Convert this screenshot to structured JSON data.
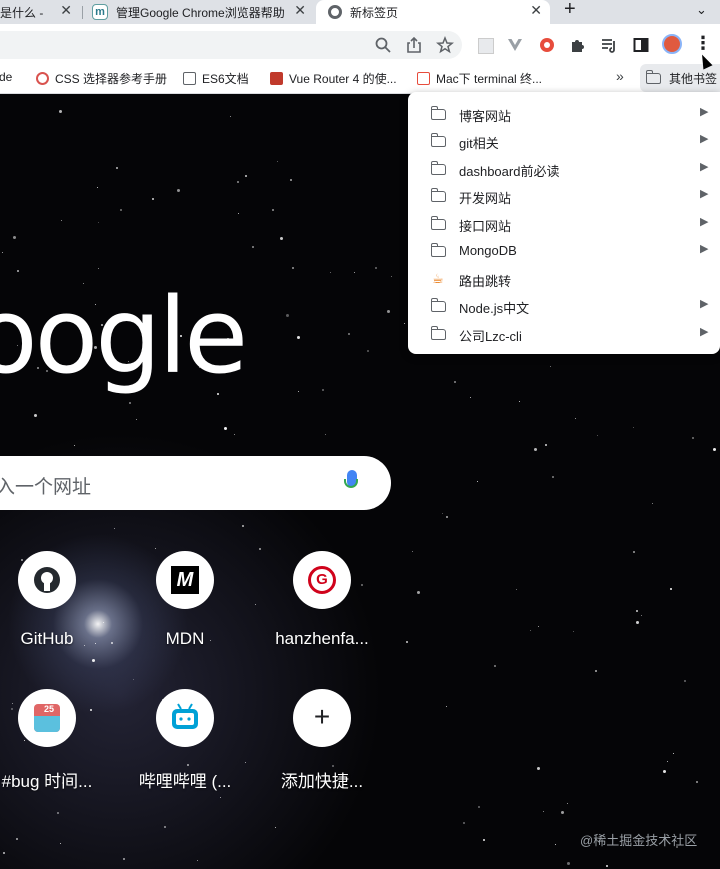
{
  "tabs": [
    {
      "title": "是什么 - ",
      "close": "✕"
    },
    {
      "title": "管理Google Chrome浏览器帮助",
      "close": "✕"
    },
    {
      "title": "新标签页",
      "close": "✕"
    }
  ],
  "toolbar": {
    "new_tab": "+",
    "tab_search": "⌄",
    "zoom_icon": "🔍",
    "share_icon": "⇪",
    "star_icon": "☆",
    "menu_icon": "⋮"
  },
  "bookmarks_bar": {
    "items": [
      {
        "label": "de",
        "icon": "none"
      },
      {
        "label": "CSS 选择器参考手册",
        "icon": "css-icon"
      },
      {
        "label": "ES6文档",
        "icon": "book-icon"
      },
      {
        "label": "Vue Router 4 的使...",
        "icon": "vue-icon"
      },
      {
        "label": "Mac下 terminal 终...",
        "icon": "code-icon"
      }
    ],
    "more": "»",
    "other": "其他书签"
  },
  "dropdown": {
    "items": [
      {
        "label": "博客网站",
        "type": "folder"
      },
      {
        "label": "git相关",
        "type": "folder"
      },
      {
        "label": "dashboard前必读",
        "type": "folder"
      },
      {
        "label": "开发网站",
        "type": "folder"
      },
      {
        "label": "接口网站",
        "type": "folder"
      },
      {
        "label": "MongoDB",
        "type": "folder"
      },
      {
        "label": "路由跳转",
        "type": "link"
      },
      {
        "label": "Node.js中文",
        "type": "folder"
      },
      {
        "label": "公司Lzc-cli",
        "type": "folder"
      }
    ],
    "arrow": "▶"
  },
  "ntp": {
    "logo": "oogle",
    "search_placeholder": "入一个网址",
    "shortcuts": [
      {
        "label": "GitHub",
        "icon": "github-icon",
        "glyph": ""
      },
      {
        "label": "MDN",
        "icon": "mdn-icon",
        "glyph": "M"
      },
      {
        "label": "hanzhenfa...",
        "icon": "hanzhenfang-icon",
        "glyph": "G"
      },
      {
        "label": "#bug 时间...",
        "icon": "calendar-icon",
        "glyph": "25"
      },
      {
        "label": "哔哩哔哩 (...",
        "icon": "bilibili-icon",
        "glyph": ""
      },
      {
        "label": "添加快捷...",
        "icon": "add-icon",
        "glyph": "+"
      }
    ],
    "watermark": "@稀土掘金技术社区"
  }
}
